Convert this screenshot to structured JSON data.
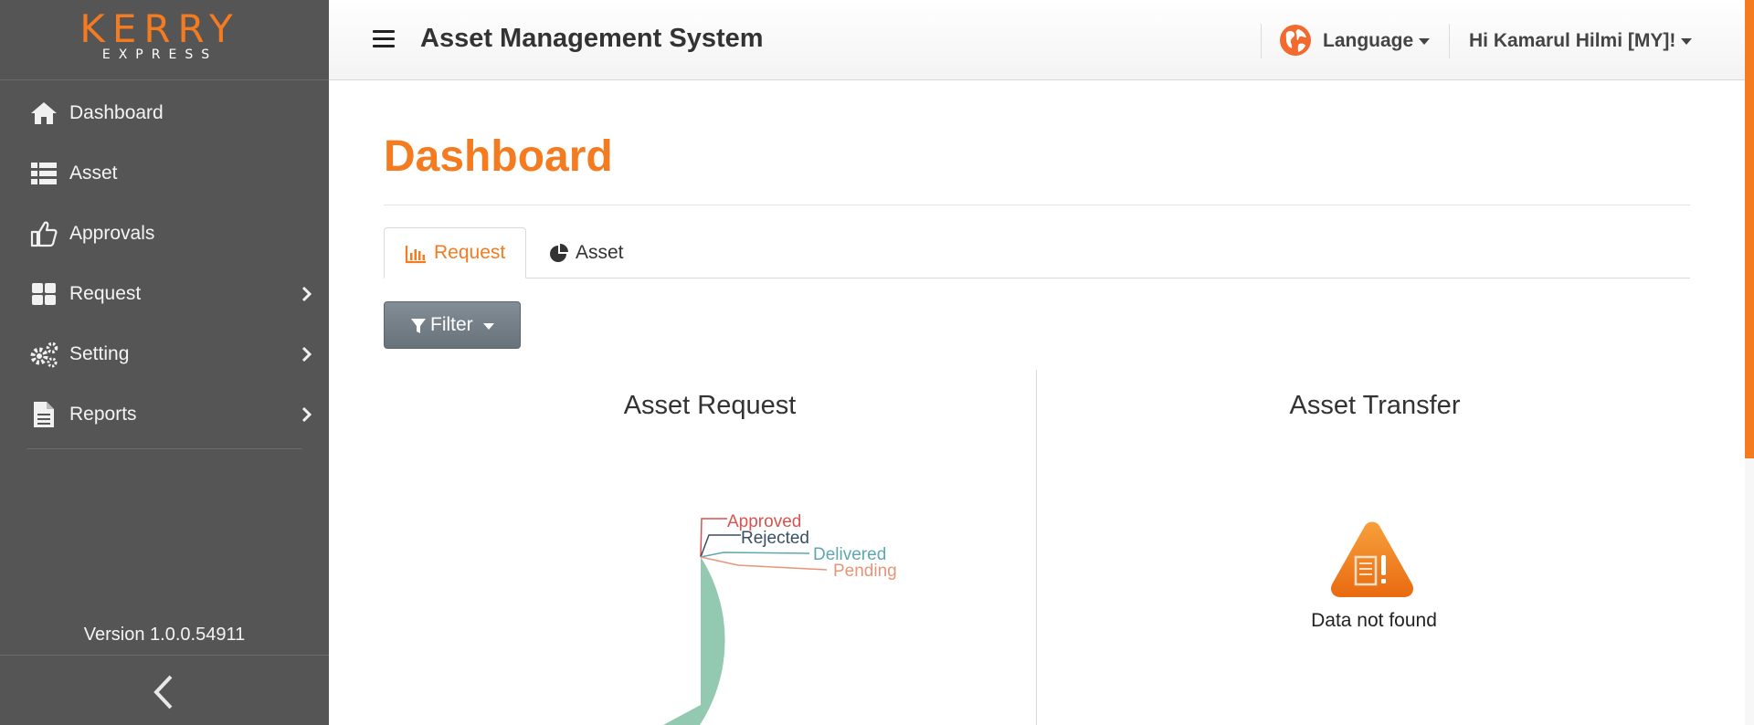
{
  "brand": {
    "logo_main": "KERRY",
    "logo_sub": "EXPRESS",
    "accent": "#f47b20"
  },
  "header": {
    "title": "Asset Management System",
    "language_label": "Language",
    "user_label": "Hi Kamarul Hilmi [MY]!"
  },
  "sidebar": {
    "items": [
      {
        "label": "Dashboard",
        "icon": "home-icon"
      },
      {
        "label": "Asset",
        "icon": "list-icon"
      },
      {
        "label": "Approvals",
        "icon": "thumbs-up-icon"
      },
      {
        "label": "Request",
        "icon": "grid-icon",
        "has_submenu": true
      },
      {
        "label": "Setting",
        "icon": "gears-icon",
        "has_submenu": true
      },
      {
        "label": "Reports",
        "icon": "document-icon",
        "has_submenu": true
      }
    ],
    "version": "Version 1.0.0.54911"
  },
  "main": {
    "page_title": "Dashboard",
    "tabs": [
      {
        "label": "Request",
        "icon": "bar-chart-icon",
        "active": true
      },
      {
        "label": "Asset",
        "icon": "pie-chart-icon",
        "active": false
      }
    ],
    "filter_label": "Filter",
    "panels": {
      "left_title": "Asset Request",
      "right_title": "Asset Transfer",
      "right_empty_text": "Data not found"
    }
  },
  "chart_data": {
    "type": "pie",
    "title": "Asset Request",
    "categories": [
      "Approved",
      "Rejected",
      "Delivered",
      "Pending"
    ],
    "values": [
      0,
      0,
      0,
      1
    ],
    "colors": {
      "Approved": "#d9534f",
      "Rejected": "#3a4f63",
      "Delivered": "#5da8b0",
      "Pending": "#e69578",
      "slice_fill": "#93c9b0"
    }
  }
}
